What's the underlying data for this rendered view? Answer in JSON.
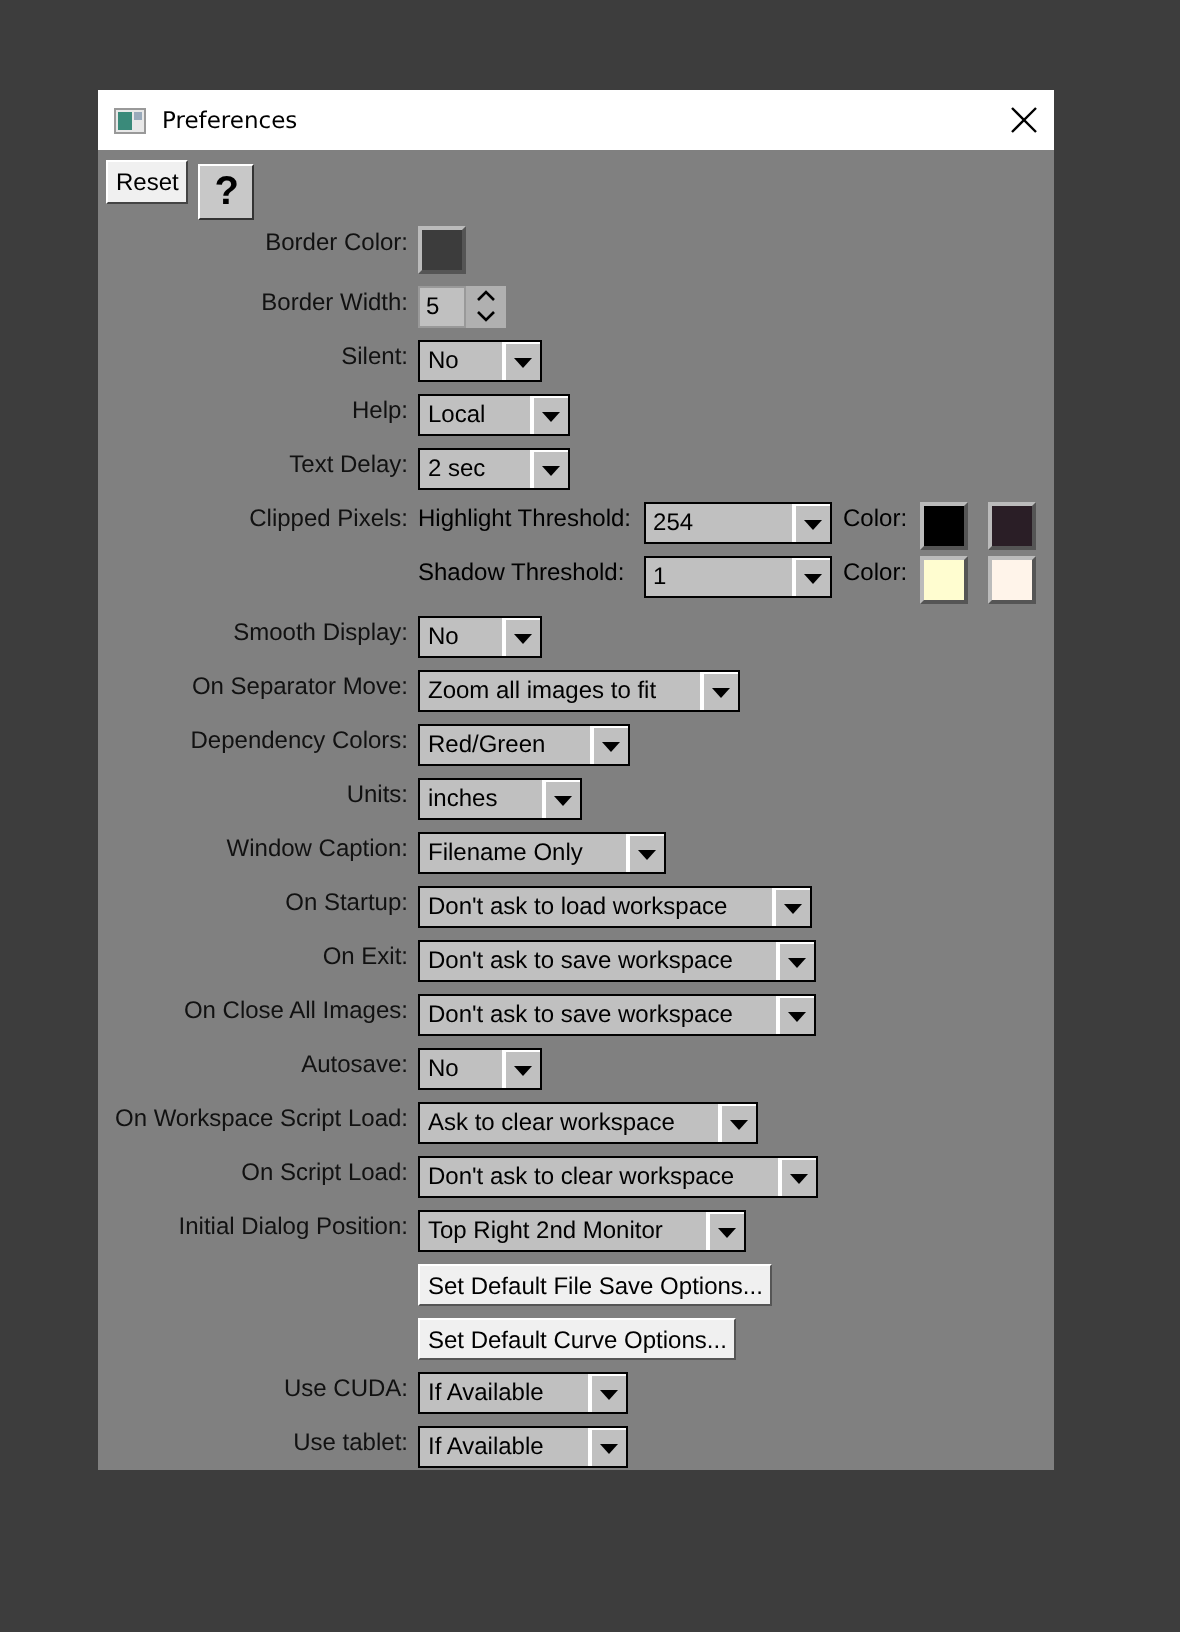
{
  "window": {
    "title": "Preferences"
  },
  "toolbar": {
    "reset": "Reset",
    "help": "?"
  },
  "rows": [
    {
      "kind": "color",
      "label": "Border Color:",
      "color": "#3c3c3c"
    },
    {
      "kind": "spinner",
      "label": "Border Width:",
      "value": "5"
    },
    {
      "kind": "dropdown",
      "label": "Silent:",
      "value": "No"
    },
    {
      "kind": "dropdown",
      "label": "Help:",
      "value": "Local"
    },
    {
      "kind": "dropdown",
      "label": "Text Delay:",
      "value": "2 sec"
    },
    {
      "kind": "clipped",
      "label": "Clipped Pixels:",
      "thresholds": [
        {
          "label": "Highlight Threshold:",
          "value": "254",
          "color_label": "Color:",
          "swatches": [
            {
              "color": "#000000"
            },
            {
              "color": "#2a1e26"
            }
          ]
        },
        {
          "label": "Shadow Threshold:",
          "value": "1",
          "color_label": "Color:",
          "swatches": [
            {
              "color": "#fffdd0"
            },
            {
              "color": "#fff4ea"
            }
          ]
        }
      ]
    },
    {
      "kind": "dropdown",
      "label": "Smooth Display:",
      "value": "No"
    },
    {
      "kind": "dropdown",
      "label": "On Separator Move:",
      "value": "Zoom all images to fit"
    },
    {
      "kind": "dropdown",
      "label": "Dependency Colors:",
      "value": "Red/Green"
    },
    {
      "kind": "dropdown",
      "label": "Units:",
      "value": "inches"
    },
    {
      "kind": "dropdown",
      "label": "Window Caption:",
      "value": "Filename Only"
    },
    {
      "kind": "dropdown",
      "label": "On Startup:",
      "value": "Don't ask to load workspace"
    },
    {
      "kind": "dropdown",
      "label": "On Exit:",
      "value": "Don't ask to save workspace"
    },
    {
      "kind": "dropdown",
      "label": "On Close All Images:",
      "value": "Don't ask to save workspace"
    },
    {
      "kind": "dropdown",
      "label": "Autosave:",
      "value": "No"
    },
    {
      "kind": "dropdown",
      "label": "On Workspace Script Load:",
      "value": "Ask to clear workspace"
    },
    {
      "kind": "dropdown",
      "label": "On Script Load:",
      "value": "Don't ask to clear workspace"
    },
    {
      "kind": "dropdown",
      "label": "Initial Dialog Position:",
      "value": "Top Right 2nd Monitor"
    },
    {
      "kind": "button",
      "value": "Set Default File Save Options..."
    },
    {
      "kind": "button",
      "value": "Set Default Curve Options..."
    },
    {
      "kind": "dropdown",
      "label": "Use CUDA:",
      "value": "If Available"
    },
    {
      "kind": "dropdown",
      "label": "Use tablet:",
      "value": "If Available"
    }
  ]
}
